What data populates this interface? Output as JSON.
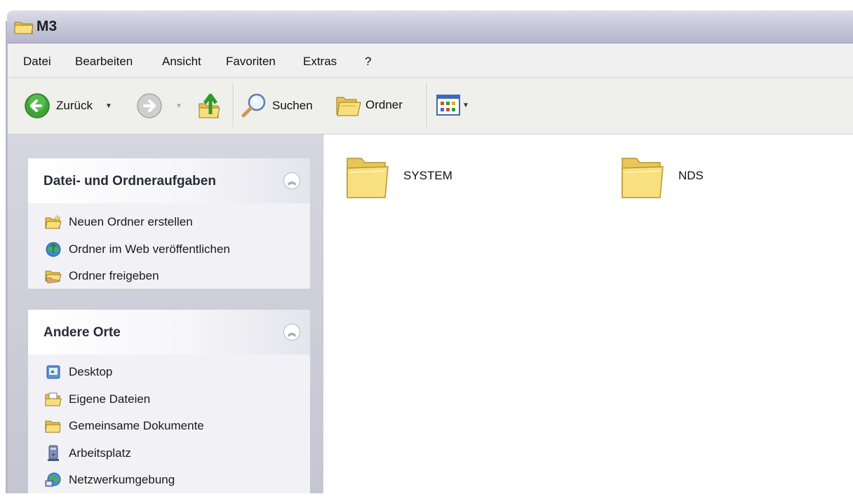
{
  "window": {
    "title": "M3"
  },
  "menu": [
    "Datei",
    "Bearbeiten",
    "Ansicht",
    "Favoriten",
    "Extras",
    "?"
  ],
  "toolbar": {
    "back_label": "Zurück",
    "search_label": "Suchen",
    "folders_label": "Ordner"
  },
  "tasks_panel": {
    "title": "Datei- und Ordneraufgaben",
    "items": [
      "Neuen Ordner erstellen",
      "Ordner im Web veröffentlichen",
      "Ordner freigeben"
    ]
  },
  "places_panel": {
    "title": "Andere Orte",
    "items": [
      "Desktop",
      "Eigene Dateien",
      "Gemeinsame Dokumente",
      "Arbeitsplatz",
      "Netzwerkumgebung"
    ]
  },
  "files": [
    {
      "name": "SYSTEM",
      "icon": "folder-icon"
    },
    {
      "name": "NDS",
      "icon": "folder-icon"
    }
  ],
  "colors": {
    "folder": "#f7d76a",
    "title_bar": "#c9c9db",
    "task_pane": "#d0d0dc"
  }
}
